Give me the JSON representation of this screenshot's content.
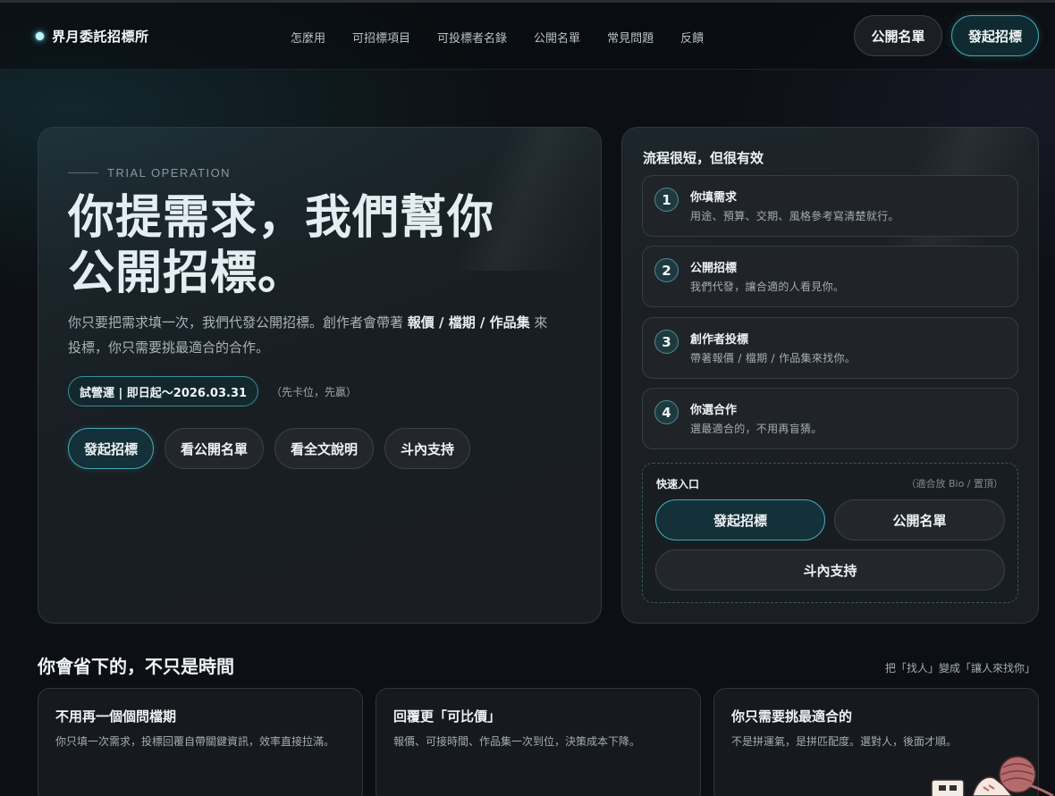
{
  "nav": {
    "brand": "界月委託招標所",
    "links": [
      "怎麼用",
      "可招標項目",
      "可投標者名錄",
      "公開名單",
      "常見問題",
      "反饋"
    ],
    "btn_list": "公開名單",
    "btn_start": "發起招標"
  },
  "hero": {
    "eyebrow": "TRIAL OPERATION",
    "title_line1": "你提需求，我們幫你",
    "title_line2": "公開招標。",
    "desc_1": "你只要把需求填一次，我們代發公開招標。創作者會帶著 ",
    "desc_bold": "報價 / 檔期 / 作品集",
    "desc_2": " 來投標，你只需要挑最適合的合作。",
    "trial_badge": "試營運 | 即日起～2026.03.31",
    "trial_note": "（先卡位，先贏）",
    "actions": [
      "發起招標",
      "看公開名單",
      "看全文說明",
      "斗內支持"
    ]
  },
  "process": {
    "title": "流程很短，但很有效",
    "steps": [
      {
        "num": "1",
        "title": "你填需求",
        "desc": "用途、預算、交期、風格參考寫清楚就行。"
      },
      {
        "num": "2",
        "title": "公開招標",
        "desc": "我們代發，讓合適的人看見你。"
      },
      {
        "num": "3",
        "title": "創作者投標",
        "desc": "帶著報價 / 檔期 / 作品集來找你。"
      },
      {
        "num": "4",
        "title": "你選合作",
        "desc": "選最適合的，不用再盲猜。"
      }
    ],
    "quick": {
      "title": "快速入口",
      "note": "（適合放 Bio / 置頂）",
      "btn_start": "發起招標",
      "btn_list": "公開名單",
      "btn_support": "斗內支持"
    }
  },
  "savings": {
    "title": "你會省下的，不只是時間",
    "note": "把「找人」變成「讓人來找你」",
    "cards": [
      {
        "title": "不用再一個個問檔期",
        "desc": "你只填一次需求，投標回覆自帶關鍵資訊，效率直接拉滿。"
      },
      {
        "title": "回覆更「可比價」",
        "desc": "報價、可接時間、作品集一次到位，決策成本下降。"
      },
      {
        "title": "你只需要挑最適合的",
        "desc": "不是拼運氣，是拼匹配度。選對人，後面才順。"
      }
    ]
  },
  "colors": {
    "accent": "#45a8b2",
    "background": "#0c1014",
    "card": "#1b1e22"
  }
}
